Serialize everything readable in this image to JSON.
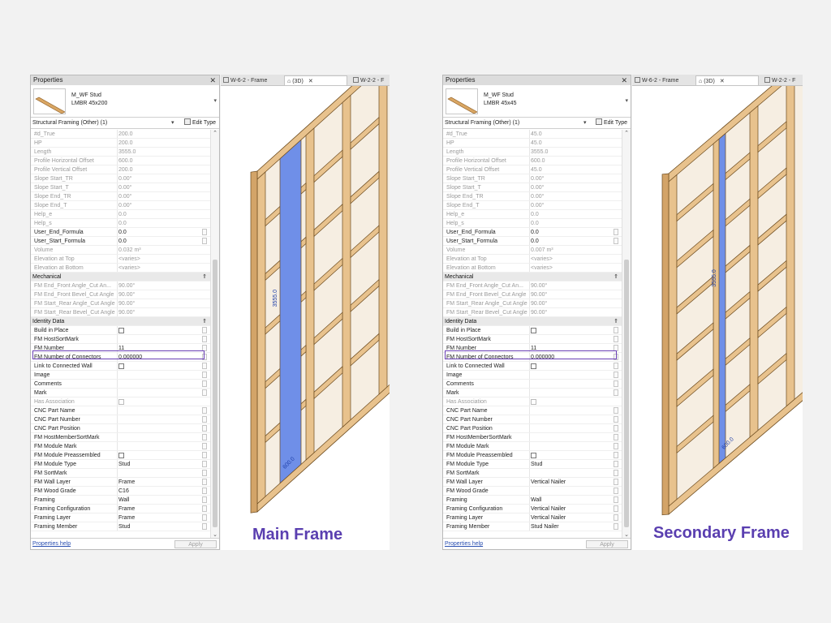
{
  "left": {
    "panel_title": "Properties",
    "type_name_line1": "M_WF Stud",
    "type_name_line2": "LMBR 45x200",
    "filter": "Structural Framing (Other) (1)",
    "edit_type": "Edit Type",
    "rows": [
      {
        "label": "#d_True",
        "value": "200.0",
        "grey": true
      },
      {
        "label": "HP",
        "value": "200.0",
        "grey": true
      },
      {
        "label": "Length",
        "value": "3555.0",
        "grey": true
      },
      {
        "label": "Profile Horizontal Offset",
        "value": "600.0",
        "grey": true
      },
      {
        "label": "Profile Vertical Offset",
        "value": "200.0",
        "grey": true
      },
      {
        "label": "Slope Start_TR",
        "value": "0.00°",
        "grey": true
      },
      {
        "label": "Slope Start_T",
        "value": "0.00°",
        "grey": true
      },
      {
        "label": "Slope End_TR",
        "value": "0.00°",
        "grey": true
      },
      {
        "label": "Slope End_T",
        "value": "0.00°",
        "grey": true
      },
      {
        "label": "Help_e",
        "value": "0.0",
        "grey": true
      },
      {
        "label": "Help_s",
        "value": "0.0",
        "grey": true
      },
      {
        "label": "User_End_Formula",
        "value": "0.0",
        "btn": true
      },
      {
        "label": "User_Start_Formula",
        "value": "0.0",
        "btn": true
      },
      {
        "label": "Volume",
        "value": "0.032 m³",
        "grey": true
      },
      {
        "label": "Elevation at Top",
        "value": "<varies>",
        "grey": true
      },
      {
        "label": "Elevation at Bottom",
        "value": "<varies>",
        "grey": true
      },
      {
        "section": "Mechanical"
      },
      {
        "label": "FM End_Front Angle_Cut An...",
        "value": "90.00°",
        "grey": true
      },
      {
        "label": "FM End_Front Bevel_Cut Angle",
        "value": "90.00°",
        "grey": true
      },
      {
        "label": "FM Start_Rear Angle_Cut Angle",
        "value": "90.00°",
        "grey": true
      },
      {
        "label": "FM Start_Rear Bevel_Cut Angle",
        "value": "90.00°",
        "grey": true
      },
      {
        "section": "Identity Data"
      },
      {
        "label": "Build in Place",
        "checkbox": true,
        "btn": true
      },
      {
        "label": "FM HostSortMark",
        "value": "",
        "btn": true
      },
      {
        "label": "FM Number",
        "value": "11",
        "btn": true
      },
      {
        "label": "FM Number of Connectors",
        "value": "0.000000",
        "btn": true
      },
      {
        "label": "Link to Connected Wall",
        "checkbox": true,
        "btn": true
      },
      {
        "label": "Image",
        "value": "",
        "btn": true
      },
      {
        "label": "Comments",
        "value": "",
        "btn": true
      },
      {
        "label": "Mark",
        "value": "",
        "btn": true
      },
      {
        "label": "Has Association",
        "checkbox": true,
        "grey": true
      },
      {
        "label": "CNC Part Name",
        "value": "",
        "btn": true
      },
      {
        "label": "CNC Part Number",
        "value": "",
        "btn": true
      },
      {
        "label": "CNC Part Position",
        "value": "",
        "btn": true
      },
      {
        "label": "FM HostMemberSortMark",
        "value": "",
        "btn": true
      },
      {
        "label": "FM Module Mark",
        "value": "",
        "btn": true
      },
      {
        "label": "FM Module Preassembled",
        "checkbox": true,
        "btn": true
      },
      {
        "label": "FM Module Type",
        "value": "Stud",
        "btn": true
      },
      {
        "label": "FM SortMark",
        "value": "",
        "btn": true
      },
      {
        "label": "FM Wall Layer",
        "value": "Frame",
        "btn": true
      },
      {
        "label": "FM Wood Grade",
        "value": "C16",
        "btn": true
      },
      {
        "label": "Framing",
        "value": "Wall",
        "btn": true
      },
      {
        "label": "Framing Configuration",
        "value": "Frame",
        "btn": true
      },
      {
        "label": "Framing Layer",
        "value": "Frame",
        "btn": true
      },
      {
        "label": "Framing Member",
        "value": "Stud",
        "btn": true
      }
    ],
    "properties_help": "Properties help",
    "apply": "Apply",
    "tabs": [
      "W-6-2 - Frame",
      "(3D)",
      "W-2-2 - F"
    ],
    "dims": [
      "3555.0",
      "600.0"
    ],
    "caption": "Main Frame"
  },
  "right": {
    "panel_title": "Properties",
    "type_name_line1": "M_WF Stud",
    "type_name_line2": "LMBR 45x45",
    "filter": "Structural Framing (Other) (1)",
    "edit_type": "Edit Type",
    "rows": [
      {
        "label": "#d_True",
        "value": "45.0",
        "grey": true
      },
      {
        "label": "HP",
        "value": "45.0",
        "grey": true
      },
      {
        "label": "Length",
        "value": "3555.0",
        "grey": true
      },
      {
        "label": "Profile Horizontal Offset",
        "value": "600.0",
        "grey": true
      },
      {
        "label": "Profile Vertical Offset",
        "value": "45.0",
        "grey": true
      },
      {
        "label": "Slope Start_TR",
        "value": "0.00°",
        "grey": true
      },
      {
        "label": "Slope Start_T",
        "value": "0.00°",
        "grey": true
      },
      {
        "label": "Slope End_TR",
        "value": "0.00°",
        "grey": true
      },
      {
        "label": "Slope End_T",
        "value": "0.00°",
        "grey": true
      },
      {
        "label": "Help_e",
        "value": "0.0",
        "grey": true
      },
      {
        "label": "Help_s",
        "value": "0.0",
        "grey": true
      },
      {
        "label": "User_End_Formula",
        "value": "0.0",
        "btn": true
      },
      {
        "label": "User_Start_Formula",
        "value": "0.0",
        "btn": true
      },
      {
        "label": "Volume",
        "value": "0.007 m³",
        "grey": true
      },
      {
        "label": "Elevation at Top",
        "value": "<varies>",
        "grey": true
      },
      {
        "label": "Elevation at Bottom",
        "value": "<varies>",
        "grey": true
      },
      {
        "section": "Mechanical"
      },
      {
        "label": "FM End_Front Angle_Cut An...",
        "value": "90.00°",
        "grey": true
      },
      {
        "label": "FM End_Front Bevel_Cut Angle",
        "value": "90.00°",
        "grey": true
      },
      {
        "label": "FM Start_Rear Angle_Cut Angle",
        "value": "90.00°",
        "grey": true
      },
      {
        "label": "FM Start_Rear Bevel_Cut Angle",
        "value": "90.00°",
        "grey": true
      },
      {
        "section": "Identity Data"
      },
      {
        "label": "Build in Place",
        "checkbox": true,
        "btn": true
      },
      {
        "label": "FM HostSortMark",
        "value": "",
        "btn": true
      },
      {
        "label": "FM Number",
        "value": "11",
        "btn": true
      },
      {
        "label": "FM Number of Connectors",
        "value": "0.000000",
        "btn": true
      },
      {
        "label": "Link to Connected Wall",
        "checkbox": true,
        "btn": true
      },
      {
        "label": "Image",
        "value": "",
        "btn": true
      },
      {
        "label": "Comments",
        "value": "",
        "btn": true
      },
      {
        "label": "Mark",
        "value": "",
        "btn": true
      },
      {
        "label": "Has Association",
        "checkbox": true,
        "grey": true
      },
      {
        "label": "CNC Part Name",
        "value": "",
        "btn": true
      },
      {
        "label": "CNC Part Number",
        "value": "",
        "btn": true
      },
      {
        "label": "CNC Part Position",
        "value": "",
        "btn": true
      },
      {
        "label": "FM HostMemberSortMark",
        "value": "",
        "btn": true
      },
      {
        "label": "FM Module Mark",
        "value": "",
        "btn": true
      },
      {
        "label": "FM Module Preassembled",
        "checkbox": true,
        "btn": true
      },
      {
        "label": "FM Module Type",
        "value": "Stud",
        "btn": true
      },
      {
        "label": "FM SortMark",
        "value": "",
        "btn": true
      },
      {
        "label": "FM Wall Layer",
        "value": "Vertical Nailer",
        "btn": true
      },
      {
        "label": "FM Wood Grade",
        "value": "",
        "btn": true
      },
      {
        "label": "Framing",
        "value": "Wall",
        "btn": true
      },
      {
        "label": "Framing Configuration",
        "value": "Vertical Nailer",
        "btn": true
      },
      {
        "label": "Framing Layer",
        "value": "Vertical Nailer",
        "btn": true
      },
      {
        "label": "Framing Member",
        "value": "Stud Nailer",
        "btn": true
      }
    ],
    "properties_help": "Properties help",
    "apply": "Apply",
    "tabs": [
      "W-6-2 - Frame",
      "(3D)",
      "W-2-2 - F"
    ],
    "dims": [
      "3555.0",
      "600.0"
    ],
    "caption": "Secondary Frame"
  },
  "colors": {
    "accent": "#5a3fb0",
    "highlight_border": "#6a3fb5",
    "timber": "#e8c28d",
    "selection": "#6f8fe8"
  }
}
